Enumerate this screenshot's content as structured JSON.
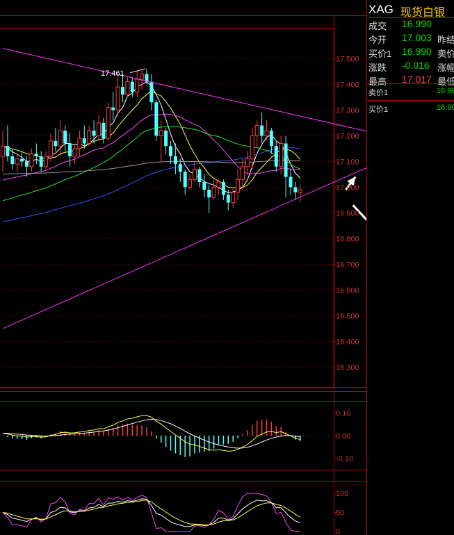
{
  "quote": {
    "symbol": "XAG",
    "name": "现货白银",
    "rows": [
      {
        "label": "成交",
        "value": "16.990",
        "color": "#00e000",
        "label2": ""
      },
      {
        "label": "今开",
        "value": "17.003",
        "color": "#00e000",
        "label2": "昨结"
      },
      {
        "label": "买价1",
        "value": "16.990",
        "color": "#00e000",
        "label2": "卖价"
      },
      {
        "label": "涨跌",
        "value": "-0.016",
        "color": "#00e000",
        "label2": "涨幅"
      },
      {
        "label": "最高",
        "value": "17.017",
        "color": "#ff4444",
        "label2": "最低"
      }
    ],
    "book": [
      {
        "label": "卖价1",
        "value": "16.99"
      },
      {
        "label": "买价1",
        "value": "16.99"
      }
    ]
  },
  "chart_data": [
    {
      "type": "candlestick",
      "ylim": [
        16.22,
        17.62
      ],
      "yticks": [
        16.3,
        16.4,
        16.5,
        16.6,
        16.7,
        16.8,
        16.9,
        17.0,
        17.1,
        17.2,
        17.3,
        17.4,
        17.5
      ],
      "ytick_labels": [
        "16.300",
        "16.400",
        "16.500",
        "16.600",
        "16.700",
        "16.800",
        "16.900",
        "17.000",
        "17.100",
        "17.200",
        "17.300",
        "17.400",
        "17.500"
      ],
      "annotation": {
        "text": "17.461",
        "value": 17.461
      },
      "up_color": "#ff3b3b",
      "down_color": "#54ffff",
      "candles": [
        [
          17.12,
          17.22,
          17.06,
          17.16
        ],
        [
          17.16,
          17.24,
          17.1,
          17.12
        ],
        [
          17.12,
          17.15,
          17.07,
          17.09
        ],
        [
          17.09,
          17.13,
          17.06,
          17.11
        ],
        [
          17.11,
          17.14,
          17.08,
          17.1
        ],
        [
          17.1,
          17.12,
          17.04,
          17.08
        ],
        [
          17.08,
          17.15,
          17.06,
          17.13
        ],
        [
          17.13,
          17.17,
          17.09,
          17.12
        ],
        [
          17.12,
          17.14,
          17.06,
          17.08
        ],
        [
          17.08,
          17.14,
          17.07,
          17.12
        ],
        [
          17.12,
          17.21,
          17.1,
          17.18
        ],
        [
          17.18,
          17.23,
          17.14,
          17.16
        ],
        [
          17.16,
          17.26,
          17.12,
          17.22
        ],
        [
          17.22,
          17.24,
          17.14,
          17.17
        ],
        [
          17.17,
          17.21,
          17.08,
          17.12
        ],
        [
          17.12,
          17.17,
          17.09,
          17.15
        ],
        [
          17.15,
          17.22,
          17.12,
          17.19
        ],
        [
          17.19,
          17.24,
          17.15,
          17.17
        ],
        [
          17.17,
          17.24,
          17.16,
          17.22
        ],
        [
          17.22,
          17.26,
          17.17,
          17.2
        ],
        [
          17.2,
          17.28,
          17.18,
          17.25
        ],
        [
          17.25,
          17.27,
          17.17,
          17.19
        ],
        [
          17.19,
          17.33,
          17.18,
          17.31
        ],
        [
          17.31,
          17.37,
          17.26,
          17.3
        ],
        [
          17.3,
          17.43,
          17.28,
          17.39
        ],
        [
          17.39,
          17.44,
          17.33,
          17.36
        ],
        [
          17.36,
          17.43,
          17.35,
          17.41
        ],
        [
          17.41,
          17.43,
          17.35,
          17.37
        ],
        [
          17.37,
          17.45,
          17.35,
          17.42
        ],
        [
          17.42,
          17.46,
          17.38,
          17.44
        ],
        [
          17.44,
          17.461,
          17.4,
          17.41
        ],
        [
          17.41,
          17.44,
          17.3,
          17.33
        ],
        [
          17.33,
          17.34,
          17.18,
          17.2
        ],
        [
          17.2,
          17.26,
          17.1,
          17.22
        ],
        [
          17.22,
          17.23,
          17.13,
          17.16
        ],
        [
          17.16,
          17.18,
          17.09,
          17.12
        ],
        [
          17.12,
          17.17,
          17.05,
          17.09
        ],
        [
          17.09,
          17.11,
          17.02,
          17.06
        ],
        [
          17.06,
          17.07,
          16.97,
          17.0
        ],
        [
          17.0,
          17.05,
          16.99,
          17.03
        ],
        [
          17.03,
          17.1,
          17.02,
          17.07
        ],
        [
          17.07,
          17.08,
          17.0,
          17.02
        ],
        [
          17.02,
          17.05,
          16.96,
          16.99
        ],
        [
          16.99,
          17.01,
          16.9,
          16.96
        ],
        [
          16.96,
          17.03,
          16.95,
          17.0
        ],
        [
          17.0,
          17.03,
          16.97,
          17.02
        ],
        [
          17.02,
          17.03,
          16.95,
          16.97
        ],
        [
          16.97,
          16.99,
          16.91,
          16.94
        ],
        [
          16.94,
          17.0,
          16.92,
          16.98
        ],
        [
          16.98,
          17.07,
          16.95,
          17.03
        ],
        [
          17.03,
          17.11,
          16.99,
          17.08
        ],
        [
          17.08,
          17.14,
          17.05,
          17.11
        ],
        [
          17.11,
          17.23,
          17.07,
          17.2
        ],
        [
          17.2,
          17.26,
          17.15,
          17.24
        ],
        [
          17.24,
          17.29,
          17.17,
          17.2
        ],
        [
          17.2,
          17.26,
          17.18,
          17.22
        ],
        [
          17.22,
          17.23,
          17.13,
          17.16
        ],
        [
          17.16,
          17.18,
          17.06,
          17.08
        ],
        [
          17.08,
          17.2,
          17.05,
          17.17
        ],
        [
          17.17,
          17.2,
          16.96,
          17.04
        ],
        [
          17.04,
          17.07,
          16.97,
          17.0
        ],
        [
          17.0,
          17.02,
          16.95,
          16.98
        ],
        [
          16.98,
          17.01,
          16.94,
          16.99
        ]
      ],
      "ma_colors": [
        "#ffffff",
        "#ffff44",
        "#ff44ff",
        "#22ee22",
        "#3355ff",
        "#999999"
      ],
      "trendlines": [
        {
          "color": "#ff33ff",
          "from": [
            0,
            17.54
          ],
          "to": [
            80,
            17.2
          ]
        },
        {
          "color": "#ff33ff",
          "from": [
            0,
            16.45
          ],
          "to": [
            80,
            17.11
          ]
        }
      ],
      "arrows": [
        {
          "from": [
            73,
            16.93
          ],
          "to": [
            79,
            16.81
          ]
        },
        {
          "from": [
            79,
            16.81
          ],
          "to": [
            88,
            16.45
          ]
        },
        {
          "from": [
            71.5,
            16.99
          ],
          "to": [
            73.5,
            17.04
          ]
        }
      ]
    },
    {
      "type": "macd",
      "ylim": [
        -0.15,
        0.15
      ],
      "yticks": [
        0.1,
        0.0,
        -0.1
      ],
      "ytick_labels": [
        "0.10",
        "0.00",
        "-0.10"
      ],
      "dif_color": "#ffff44",
      "dea_color": "#ffffff"
    },
    {
      "type": "kdj",
      "ylim": [
        0,
        100
      ],
      "yticks": [
        100,
        50,
        0
      ],
      "ytick_labels": [
        "100",
        "50",
        "0"
      ],
      "k_color": "#ffffff",
      "d_color": "#ffff44",
      "j_color": "#ff44ff"
    }
  ]
}
